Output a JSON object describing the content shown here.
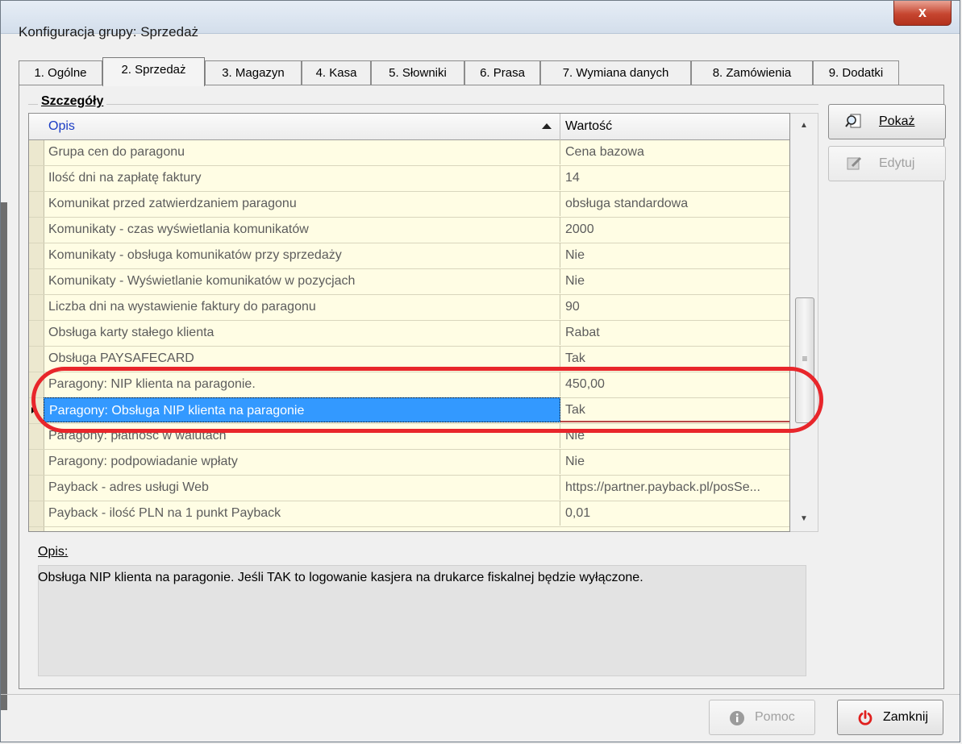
{
  "window": {
    "title": "Konfiguracja grupy: Sprzedaż",
    "close_label": "x"
  },
  "tabs": [
    {
      "label": "1. Ogólne",
      "active": false
    },
    {
      "label": "2. Sprzedaż",
      "active": true
    },
    {
      "label": "3. Magazyn",
      "active": false
    },
    {
      "label": "4. Kasa",
      "active": false
    },
    {
      "label": "5. Słowniki",
      "active": false
    },
    {
      "label": "6. Prasa",
      "active": false
    },
    {
      "label": "7. Wymiana danych",
      "active": false
    },
    {
      "label": "8. Zamówienia",
      "active": false
    },
    {
      "label": "9. Dodatki",
      "active": false
    }
  ],
  "details": {
    "group_label": "Szczegóły",
    "columns": {
      "desc": "Opis",
      "value": "Wartość"
    },
    "rows": [
      {
        "desc": "Grupa cen do paragonu",
        "value": "Cena bazowa"
      },
      {
        "desc": "Ilość dni na zapłatę faktury",
        "value": "14"
      },
      {
        "desc": "Komunikat przed zatwierdzaniem paragonu",
        "value": "obsługa standardowa"
      },
      {
        "desc": "Komunikaty - czas wyświetlania komunikatów",
        "value": "2000"
      },
      {
        "desc": "Komunikaty - obsługa komunikatów przy sprzedaży",
        "value": "Nie"
      },
      {
        "desc": "Komunikaty - Wyświetlanie komunikatów w pozycjach",
        "value": "Nie"
      },
      {
        "desc": "Liczba dni na wystawienie faktury do paragonu",
        "value": "90"
      },
      {
        "desc": "Obsługa karty stałego klienta",
        "value": "Rabat"
      },
      {
        "desc": "Obsługa PAYSAFECARD",
        "value": "Tak"
      },
      {
        "desc": "Paragony: NIP klienta na paragonie.",
        "value": "450,00"
      },
      {
        "desc": "Paragony: Obsługa NIP klienta na paragonie",
        "value": "Tak",
        "selected": true
      },
      {
        "desc": "Paragony: płatność w walutach",
        "value": "Nie"
      },
      {
        "desc": "Paragony: podpowiadanie wpłaty",
        "value": "Nie"
      },
      {
        "desc": "Payback - adres usługi Web",
        "value": "https://partner.payback.pl/posSe..."
      },
      {
        "desc": "Payback - ilość PLN na 1 punkt Payback",
        "value": "0,01"
      }
    ]
  },
  "buttons": {
    "show": "Pokaż",
    "edit": "Edytuj",
    "help": "Pomoc",
    "close": "Zamknij"
  },
  "description": {
    "label": "Opis:",
    "text": "Obsługa NIP klienta na paragonie. Jeśli TAK to logowanie kasjera na drukarce fiskalnej będzie wyłączone."
  },
  "colors": {
    "selection": "#3399ff",
    "grid_background": "#fffde4",
    "annotation": "#e8262b",
    "header_link": "#1a3cc4"
  },
  "icons": {
    "show": "magnifier-document-icon",
    "edit": "edit-document-icon",
    "help": "info-icon",
    "close": "power-icon"
  }
}
